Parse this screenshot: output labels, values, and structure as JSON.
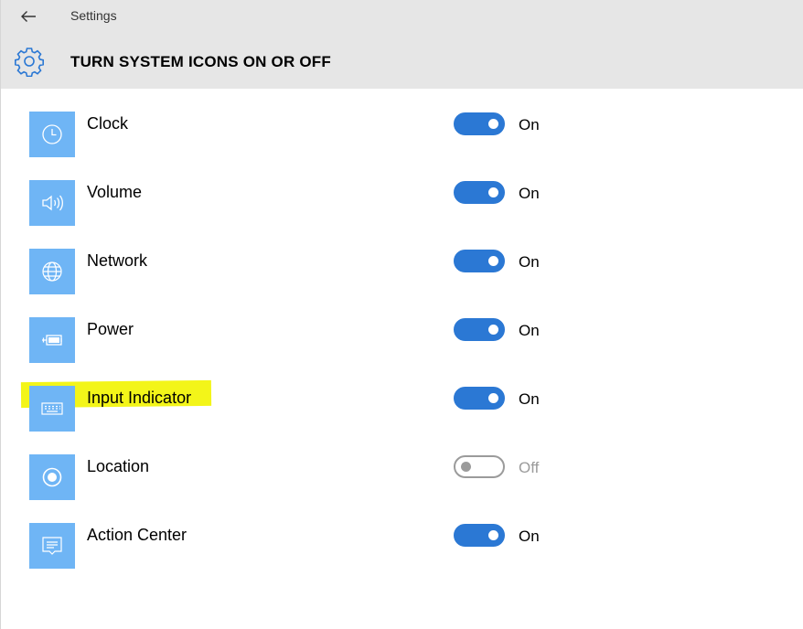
{
  "window": {
    "title": "Settings"
  },
  "header": {
    "title": "TURN SYSTEM ICONS ON OR OFF"
  },
  "colors": {
    "tile": "#6fb5f5",
    "toggle_on": "#2b78d4",
    "toggle_off_border": "#9b9b9b",
    "highlight": "#f2f400"
  },
  "items": [
    {
      "label": "Clock",
      "icon": "clock-icon",
      "state": "On",
      "enabled": true
    },
    {
      "label": "Volume",
      "icon": "speaker-icon",
      "state": "On",
      "enabled": true
    },
    {
      "label": "Network",
      "icon": "globe-icon",
      "state": "On",
      "enabled": true
    },
    {
      "label": "Power",
      "icon": "battery-icon",
      "state": "On",
      "enabled": true
    },
    {
      "label": "Input Indicator",
      "icon": "keyboard-icon",
      "state": "On",
      "enabled": true,
      "highlighted": true
    },
    {
      "label": "Location",
      "icon": "location-icon",
      "state": "Off",
      "enabled": false
    },
    {
      "label": "Action Center",
      "icon": "action-center-icon",
      "state": "On",
      "enabled": true
    }
  ]
}
